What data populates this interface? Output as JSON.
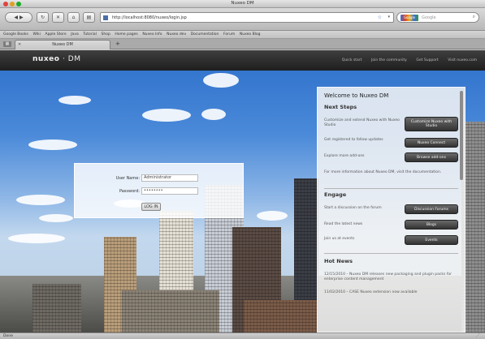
{
  "window": {
    "title": "Nuxeo DM"
  },
  "toolbar": {
    "back_icon": "◀",
    "forward_icon": "▶",
    "reload_icon": "↻",
    "home_icon": "⌂",
    "url": "http://localhost:8080/nuxeo/login.jsp",
    "search_placeholder": "Google",
    "search_logo": "Google"
  },
  "bookmarks": [
    "Google Books",
    "Wiki",
    "Apple Store",
    "Java",
    "Tutorial",
    "Shop",
    "Home pages",
    "Nuxeo Info",
    "Nuxeo dev",
    "Documentation",
    "Forum",
    "Nuxeo Blog"
  ],
  "tabs": [
    {
      "label": "Nuxeo DM"
    }
  ],
  "nav": {
    "logo": "nuxeo",
    "logo_suffix": "DM",
    "links": [
      "Quick start",
      "Join the community",
      "Get Support",
      "Visit nuxeo.com"
    ]
  },
  "login": {
    "username_label": "User Name:",
    "username_value": "Administrator",
    "password_label": "Password:",
    "password_value": "••••••••",
    "submit": "LOG IN"
  },
  "welcome": {
    "title": "Welcome to Nuxeo DM",
    "next_steps": {
      "heading": "Next Steps",
      "items": [
        {
          "text": "Customize and extend Nuxeo with Nuxeo Studio",
          "button": "Customize Nuxeo with Studio"
        },
        {
          "text": "Get registered to follow updates",
          "button": "Nuxeo Connect"
        },
        {
          "text": "Explore more add-ons",
          "button": "Browse add-ons"
        }
      ],
      "note": "For more information about Nuxeo DM, visit the documentation."
    },
    "engage": {
      "heading": "Engage",
      "items": [
        {
          "text": "Start a discussion on the forum",
          "button": "Discussion Forums"
        },
        {
          "text": "Read the latest news",
          "button": "Blogs"
        },
        {
          "text": "Join us at events",
          "button": "Events"
        }
      ]
    },
    "news": {
      "heading": "Hot News",
      "items": [
        "12/15/2010 – Nuxeo DM releases new packaging and plugin packs for enterprise content management",
        "11/02/2010 – CASE Nuxeo extension now available"
      ]
    }
  },
  "status": {
    "text": "Done"
  },
  "colors": {
    "nav_bg": "#2a2a2a",
    "sky_top": "#2d6fcb",
    "button_dark": "#3c3c3c"
  }
}
